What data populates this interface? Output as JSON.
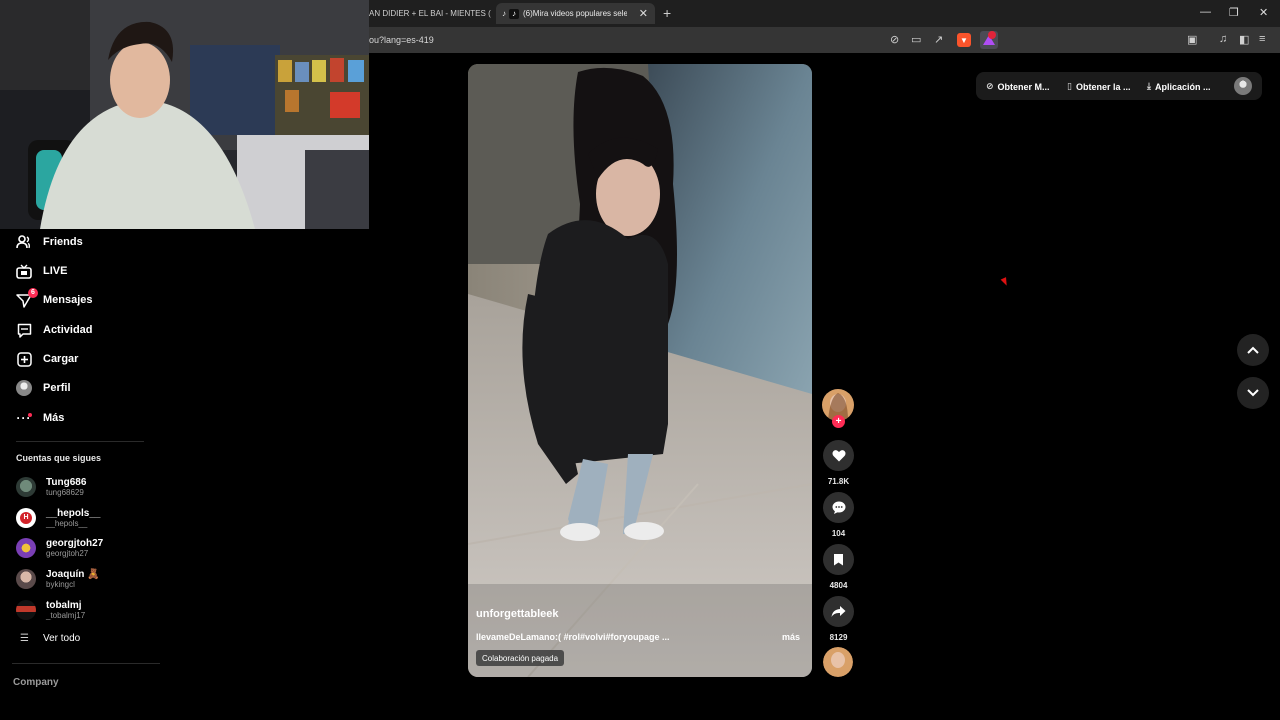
{
  "browser": {
    "tabs": [
      {
        "title": "AN DIDIER + EL BAI - MIENTES ("
      },
      {
        "title": "(6)Mira videos populares sele"
      }
    ],
    "url": "ou?lang=es-419"
  },
  "sidebar": {
    "nav": [
      {
        "label": "Friends",
        "icon": "friends-icon"
      },
      {
        "label": "LIVE",
        "icon": "live-icon"
      },
      {
        "label": "Mensajes",
        "icon": "messages-icon",
        "badge": "6"
      },
      {
        "label": "Actividad",
        "icon": "activity-icon"
      },
      {
        "label": "Cargar",
        "icon": "upload-icon"
      },
      {
        "label": "Perfil",
        "icon": "profile-icon"
      },
      {
        "label": "Más",
        "icon": "more-icon"
      }
    ],
    "following_header": "Cuentas que sigues",
    "accounts": [
      {
        "name": "Tung686",
        "username": "tung68629"
      },
      {
        "name": "__hepols__",
        "username": "__hepols__"
      },
      {
        "name": "georgjtoh27",
        "username": "georgjtoh27"
      },
      {
        "name": "Joaquín 🧸",
        "username": "bykingcl"
      },
      {
        "name": "tobalmj",
        "username": "_tobalmj17"
      }
    ],
    "see_all": "Ver todo",
    "company": "Company"
  },
  "video": {
    "author": "unforgettableek",
    "caption": "llevameDeLamano:( #rol#volvi#foryoupage ...",
    "more": "más",
    "paid_badge": "Colaboración pagada"
  },
  "actions": {
    "likes": "71.8K",
    "comments": "104",
    "saves": "4804",
    "shares": "8129"
  },
  "top": {
    "get_coins": "Obtener M...",
    "get_app": "Obtener la ...",
    "app": "Aplicación ..."
  },
  "colors": {
    "accent": "#fe2c55",
    "background": "#000000"
  }
}
